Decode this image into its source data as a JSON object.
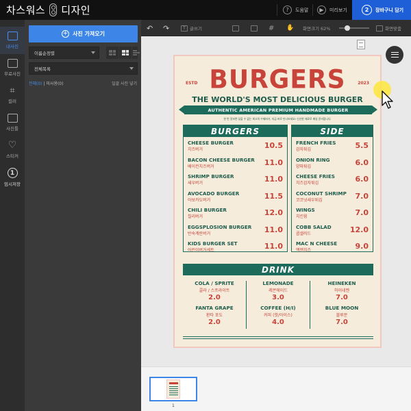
{
  "header": {
    "brand_left": "차스워스",
    "brand_right": "디자인",
    "help_label": "도움말",
    "preview_label": "미리보기",
    "cart_number": "2",
    "cart_label": "장바구니 담기"
  },
  "rail": {
    "items": [
      {
        "label": "내사진",
        "icon": "photo-icon"
      },
      {
        "label": "무료사진",
        "icon": "free-photo-icon"
      },
      {
        "label": "컬러",
        "icon": "crop-icon"
      },
      {
        "label": "사진틀",
        "icon": "frame-icon"
      },
      {
        "label": "스티커",
        "icon": "heart-icon"
      },
      {
        "label": "임시저장",
        "icon": "save-icon",
        "glyph": "1"
      }
    ]
  },
  "panel": {
    "import_label": "사진 가져오기",
    "sort_value": "이름순정렬",
    "filter_value": "전체목록",
    "link_all": "전체(0)",
    "link_unused": "미사용(0)",
    "hide_label": "일괄 사진 넣기"
  },
  "toolbar": {
    "undo": "↶",
    "redo": "↷",
    "text_label": "글쓰기",
    "zoom_label": "화면크기 62%",
    "fit_label": "화면맞춤"
  },
  "menu": {
    "estd": "ESTD",
    "year": "2023",
    "title": "BURGERS",
    "subtitle": "THE WORLD'S MOST DELICIOUS BURGER",
    "banner": "AUTHENTIC AMERICAN PREMIUM HANDMADE BURGER",
    "tagline": "한 번 맛보면 잊을 수 없는 최고의 수제버거, 지금 바로 만나보세요! 신선한 재료로 매일 준비합니다.",
    "burgers_head": "BURGERS",
    "burgers": [
      {
        "en": "CHEESE BURGER",
        "ko": "치즈버거",
        "price": "10.5"
      },
      {
        "en": "BACON CHEESE BURGER",
        "ko": "베이컨치즈버거",
        "price": "11.0"
      },
      {
        "en": "SHRIMP BURGER",
        "ko": "새우버거",
        "price": "11.0"
      },
      {
        "en": "AVOCADO BURGER",
        "ko": "아보카도버거",
        "price": "11.5"
      },
      {
        "en": "CHILI BURGER",
        "ko": "칠리버거",
        "price": "12.0"
      },
      {
        "en": "EGGSPLOSION BURGER",
        "ko": "반숙계란버거",
        "price": "11.0"
      },
      {
        "en": "KIDS BURGER SET",
        "ko": "어린이버거세트",
        "price": "11.0"
      }
    ],
    "side_head": "SIDE",
    "sides": [
      {
        "en": "FRENCH FRIES",
        "ko": "감자튀김",
        "price": "5.5"
      },
      {
        "en": "ONION RING",
        "ko": "양파튀김",
        "price": "6.0"
      },
      {
        "en": "CHEESE FRIES",
        "ko": "치즈감자튀김",
        "price": "6.0"
      },
      {
        "en": "COCONUT SHRIMP",
        "ko": "코코넛새우튀김",
        "price": "7.0"
      },
      {
        "en": "WINGS",
        "ko": "치킨윙",
        "price": "7.0"
      },
      {
        "en": "COBB SALAD",
        "ko": "콥샐러드",
        "price": "12.0"
      },
      {
        "en": "MAC N CHEESE",
        "ko": "맥앤치즈",
        "price": "9.0"
      }
    ],
    "drink_head": "DRINK",
    "drinks": [
      {
        "en": "COLA / SPRITE",
        "ko": "콜라 / 스프라이트",
        "price": "2.0"
      },
      {
        "en": "LEMONADE",
        "ko": "레몬에이드",
        "price": "3.0"
      },
      {
        "en": "HEINEKEN",
        "ko": "하이네켄",
        "price": "7.0"
      },
      {
        "en": "FANTA GRAPE",
        "ko": "환타 포도",
        "price": "2.0"
      },
      {
        "en": "COFFEE (H/I)",
        "ko": "커피 (핫/아이스)",
        "price": "4.0"
      },
      {
        "en": "BLUE MOON",
        "ko": "블루문",
        "price": "7.0"
      }
    ]
  },
  "thumbs": {
    "page_number": "1"
  },
  "colors": {
    "accent_blue": "#3d86e8",
    "cart_blue": "#1e5fd8",
    "menu_red": "#c8433a",
    "menu_green": "#1d6b5a",
    "menu_bg": "#f6ecdb"
  }
}
